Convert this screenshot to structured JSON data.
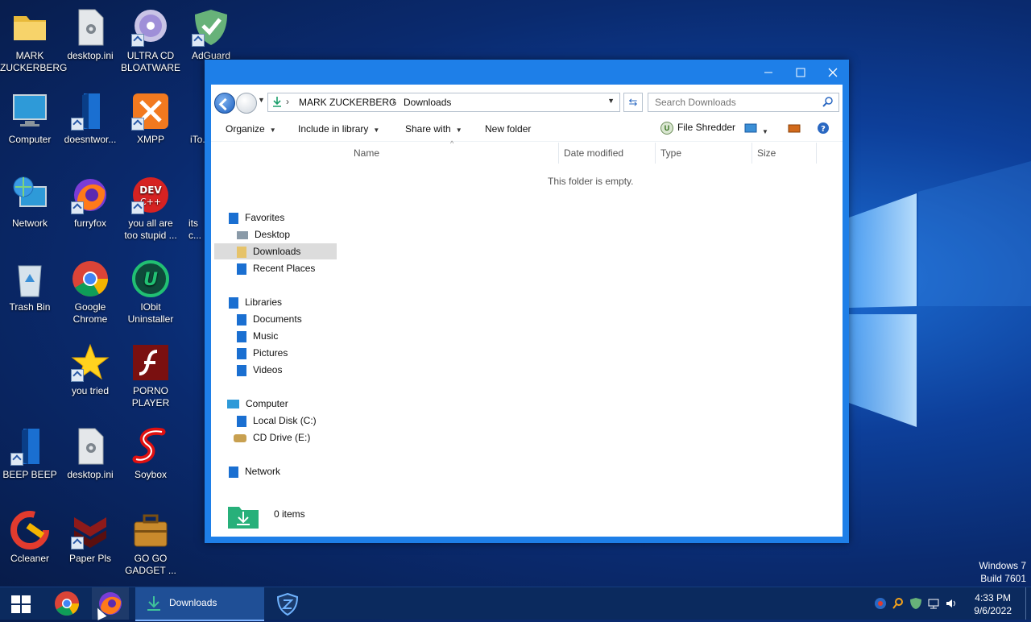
{
  "desktop": {
    "icons": [
      {
        "label": "MARK ZUCKERBERG",
        "icon": "folder-icon"
      },
      {
        "label": "desktop.ini",
        "icon": "settings-file-icon"
      },
      {
        "label": "ULTRA CD BLOATWARE",
        "icon": "cd-icon"
      },
      {
        "label": "AdGuard",
        "icon": "shield-icon"
      },
      {
        "label": "Computer",
        "icon": "monitor-icon"
      },
      {
        "label": "doesntwor...",
        "icon": "file-icon"
      },
      {
        "label": "XMPP",
        "icon": "xampp-icon"
      },
      {
        "label": "iTo...",
        "icon": "file-icon"
      },
      {
        "label": "Network",
        "icon": "network-globe-icon"
      },
      {
        "label": "furryfox",
        "icon": "firefox-icon"
      },
      {
        "label": "you all are too stupid ...",
        "icon": "devcpp-icon"
      },
      {
        "label": "its c...",
        "icon": "document-icon"
      },
      {
        "label": "Trash Bin",
        "icon": "recycle-bin-icon"
      },
      {
        "label": "Google Chrome",
        "icon": "chrome-icon"
      },
      {
        "label": "IObit Uninstaller",
        "icon": "iobit-icon"
      },
      {
        "label": "you tried",
        "icon": "star-icon"
      },
      {
        "label": "PORNO PLAYER",
        "icon": "flash-icon"
      },
      {
        "label": "BEEP BEEP",
        "icon": "file-icon"
      },
      {
        "label": "desktop.ini",
        "icon": "settings-file-icon"
      },
      {
        "label": "Soybox",
        "icon": "soybox-icon"
      },
      {
        "label": "Ccleaner",
        "icon": "ccleaner-icon"
      },
      {
        "label": "Paper Pls",
        "icon": "paperpls-icon"
      },
      {
        "label": "GO GO GADGET ...",
        "icon": "briefcase-icon"
      }
    ]
  },
  "explorer": {
    "address": {
      "segment1": "MARK ZUCKERBERG",
      "segment2": "Downloads"
    },
    "search": {
      "placeholder": "Search Downloads"
    },
    "toolbar": {
      "organize": "Organize",
      "include": "Include in library",
      "share": "Share with",
      "new_folder": "New folder",
      "file_shredder": "File Shredder",
      "shredder_badge": "U"
    },
    "nav": {
      "favorites": "Favorites",
      "desktop": "Desktop",
      "downloads": "Downloads",
      "recent": "Recent Places",
      "libraries": "Libraries",
      "documents": "Documents",
      "music": "Music",
      "pictures": "Pictures",
      "videos": "Videos",
      "computer": "Computer",
      "local_disk": "Local Disk (C:)",
      "cd_drive": "CD Drive (E:)",
      "network": "Network"
    },
    "columns": {
      "name": "Name",
      "date": "Date modified",
      "type": "Type",
      "size": "Size"
    },
    "empty_message": "This folder is empty.",
    "status": {
      "count": "0 items"
    }
  },
  "watermark": {
    "line1": "Windows 7",
    "line2": "Build 7601"
  },
  "taskbar": {
    "active_task": "Downloads",
    "time": "4:33 PM",
    "date": "9/6/2022"
  },
  "colors": {
    "window_border": "#1e7fe8",
    "taskbar": "#0b2a5e",
    "accent": "#2a68c2"
  }
}
